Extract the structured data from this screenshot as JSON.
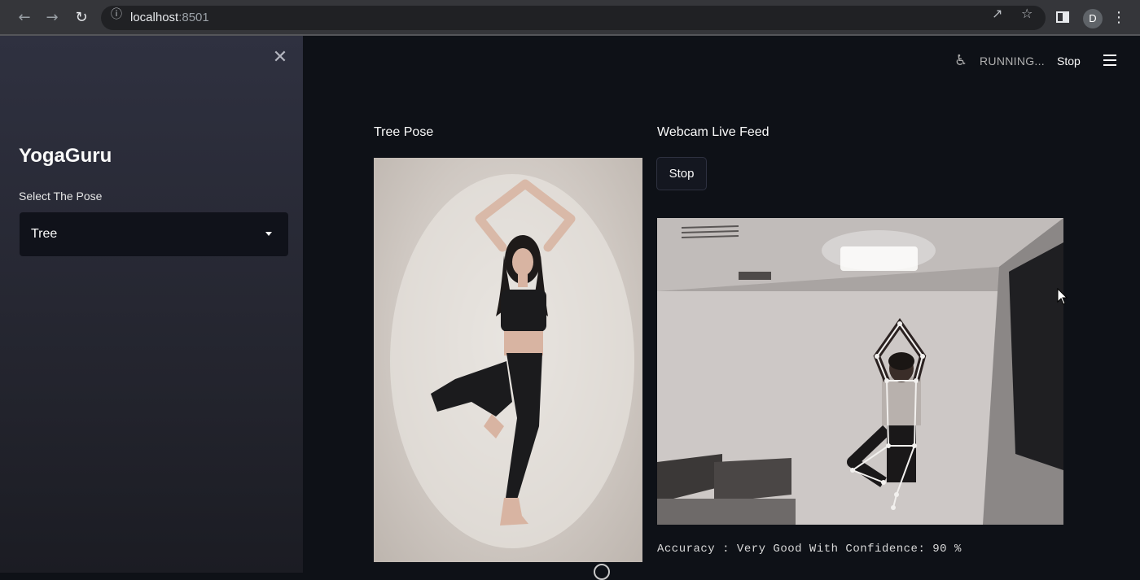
{
  "browser": {
    "url_host": "localhost",
    "url_port": ":8501",
    "profile_initial": "D"
  },
  "sidebar": {
    "app_title": "YogaGuru",
    "select_label": "Select The Pose",
    "select_value": "Tree"
  },
  "status": {
    "running_text": "RUNNING...",
    "stop_label": "Stop"
  },
  "main": {
    "reference_header": "Tree Pose",
    "webcam_header": "Webcam Live Feed",
    "webcam_stop_label": "Stop",
    "accuracy_text": "Accuracy : Very Good With Confidence: 90 %"
  },
  "icons": {
    "back": "arrow-left-icon",
    "forward": "arrow-right-icon",
    "reload": "reload-icon",
    "info": "info-icon",
    "share": "share-icon",
    "star": "star-icon",
    "side_panel": "side-panel-icon",
    "more": "more-vertical-icon",
    "close": "close-icon",
    "running": "running-man-icon",
    "menu": "hamburger-menu-icon"
  },
  "colors": {
    "app_background": "#0e1117",
    "sidebar_background": "#2f3140",
    "select_background": "#10121a",
    "text": "#fafafa"
  }
}
